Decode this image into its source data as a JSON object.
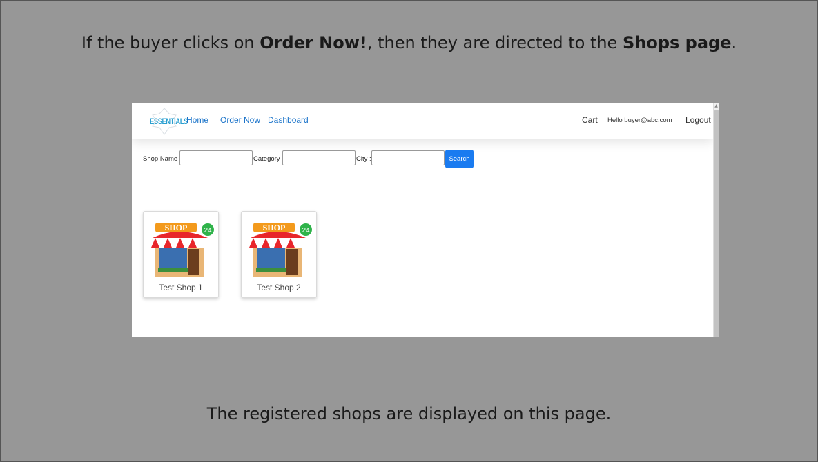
{
  "slide": {
    "caption_top_1": "If the buyer clicks on ",
    "caption_top_bold_1": "Order Now!",
    "caption_top_2": ", then they are directed to the ",
    "caption_top_bold_2": "Shops page",
    "caption_top_3": ".",
    "caption_bottom": "The registered shops are displayed on this page."
  },
  "app": {
    "logo_text": "ESSENTIALS",
    "nav": {
      "home": "Home",
      "order_now": "Order Now",
      "dashboard": "Dashboard",
      "cart": "Cart",
      "greeting": "Hello buyer@abc.com",
      "logout": "Logout"
    },
    "search": {
      "shop_name_label": "Shop Name :",
      "category_label": "Category :",
      "city_label": "City :",
      "shop_name_value": "",
      "category_value": "",
      "city_value": "",
      "button_label": "Search"
    },
    "shops": [
      {
        "name": "Test Shop 1",
        "sign": "SHOP",
        "badge": "24"
      },
      {
        "name": "Test Shop 2",
        "sign": "SHOP",
        "badge": "24"
      }
    ]
  },
  "colors": {
    "slide_background": "#979797",
    "nav_link": "#1a73c9",
    "search_button": "#1a7bf0",
    "logo": "#2a9fd0",
    "awning_red": "#e8262b",
    "badge_green": "#2fb34a"
  }
}
